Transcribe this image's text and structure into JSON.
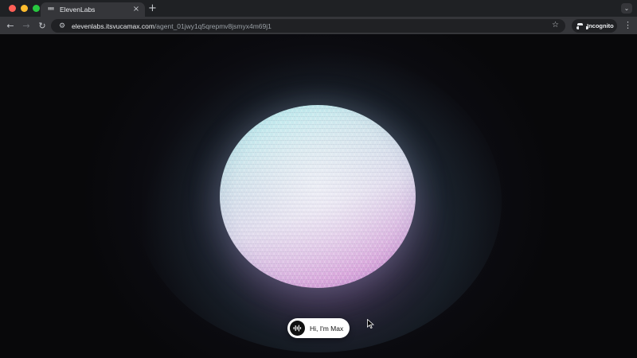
{
  "browser": {
    "tab": {
      "favicon": "ᐦᐦ",
      "title": "ElevenLabs",
      "close_glyph": "×"
    },
    "new_tab_glyph": "+",
    "tab_search_glyph": "⌄",
    "nav": {
      "back_glyph": "←",
      "forward_glyph": "→",
      "reload_glyph": "↻"
    },
    "omnibox": {
      "site_icon_glyph": "⚙",
      "url_host": "elevenlabs.itsvucamax.com",
      "url_path": "/agent_01jwy1q5qrepmv8jsmyx4m69j1",
      "star_glyph": "☆"
    },
    "profile": {
      "label": "Incognito"
    },
    "menu_glyph": "⋮"
  },
  "page": {
    "agent_button": {
      "label": "Hi, I'm Max"
    }
  },
  "colors": {
    "orb_top": "#a9ecec",
    "orb_bottom": "#c88bd4",
    "background": "#0b0b10"
  }
}
